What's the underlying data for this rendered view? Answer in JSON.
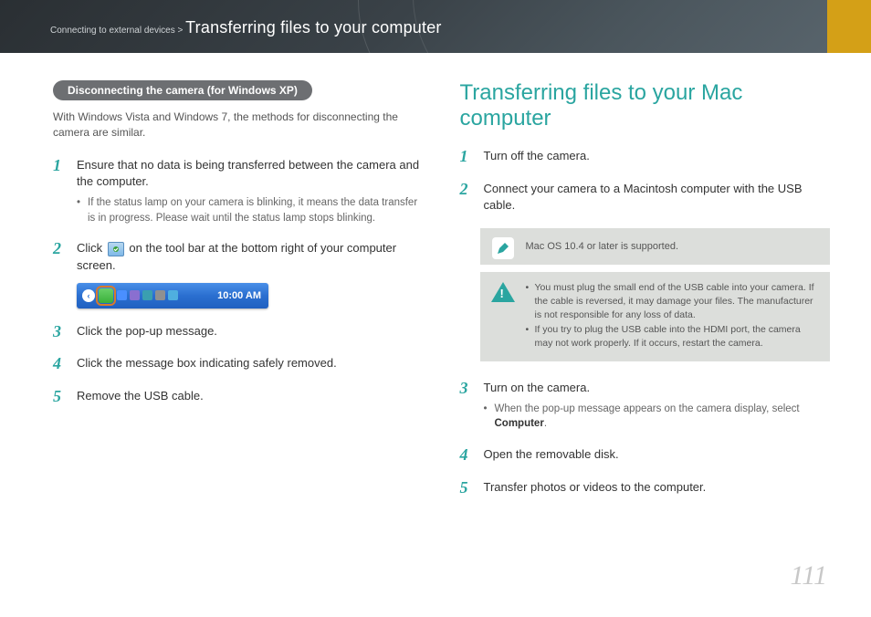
{
  "header": {
    "breadcrumb_section": "Connecting to external devices > ",
    "breadcrumb_page": "Transferring files to your computer"
  },
  "left": {
    "subhead": "Disconnecting the camera (for Windows XP)",
    "intro": "With Windows Vista and Windows 7, the methods for disconnecting the camera are similar.",
    "steps": [
      {
        "n": "1",
        "text": "Ensure that no data is being transferred between the camera and the computer.",
        "sub": "If the status lamp on your camera is blinking, it means the data transfer is in progress. Please wait until the status lamp stops blinking."
      },
      {
        "n": "2",
        "text_before": "Click ",
        "text_after": " on the tool bar at the bottom right of your computer screen.",
        "taskbar_time": "10:00 AM"
      },
      {
        "n": "3",
        "text": "Click the pop-up message."
      },
      {
        "n": "4",
        "text": "Click the message box indicating safely removed."
      },
      {
        "n": "5",
        "text": "Remove the USB cable."
      }
    ]
  },
  "right": {
    "title": "Transferring files to your Mac computer",
    "steps": [
      {
        "n": "1",
        "text": "Turn off the camera."
      },
      {
        "n": "2",
        "text": "Connect your camera to a Macintosh computer with the USB cable."
      }
    ],
    "note1": "Mac OS 10.4 or later is supported.",
    "warn": [
      "You must plug the small end of the USB cable into your camera. If the cable is reversed, it may damage your files. The manufacturer is not responsible for any loss of data.",
      "If you try to plug the USB cable into the HDMI port, the camera may not work properly. If it occurs, restart the camera."
    ],
    "steps2": [
      {
        "n": "3",
        "text": "Turn on the camera.",
        "sub_before": "When the pop-up message appears on the camera display, select ",
        "sub_bold": "Computer",
        "sub_after": "."
      },
      {
        "n": "4",
        "text": "Open the removable disk."
      },
      {
        "n": "5",
        "text": "Transfer photos or videos to the computer."
      }
    ]
  },
  "page_number": "111"
}
